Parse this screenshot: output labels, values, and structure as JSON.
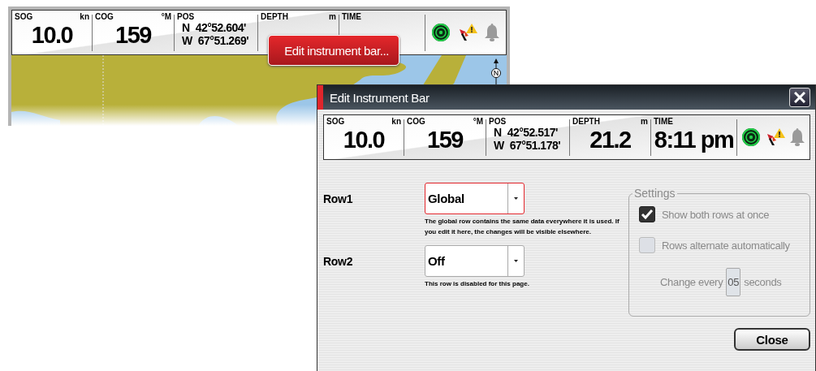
{
  "background_screen": {
    "instrument_bar": {
      "cells": [
        {
          "kind": "value",
          "label": "SOG",
          "unit": "kn",
          "value": "10.0"
        },
        {
          "kind": "value",
          "label": "COG",
          "unit": "°M",
          "value": "159"
        },
        {
          "kind": "position",
          "label": "POS",
          "lines": [
            {
              "prefix": "N",
              "value": "42°52.604'"
            },
            {
              "prefix": "W",
              "value": "67°51.269'"
            }
          ]
        },
        {
          "kind": "value",
          "label": "DEPTH",
          "unit": "m"
        },
        {
          "kind": "value",
          "label": "TIME"
        }
      ]
    },
    "context_menu": {
      "item": "Edit instrument bar..."
    }
  },
  "dialog": {
    "title": "Edit Instrument Bar",
    "instrument_bar": {
      "cells": [
        {
          "kind": "value",
          "label": "SOG",
          "unit": "kn",
          "value": "10.0"
        },
        {
          "kind": "value",
          "label": "COG",
          "unit": "°M",
          "value": "159"
        },
        {
          "kind": "position",
          "label": "POS",
          "lines": [
            {
              "prefix": "N",
              "value": "42°52.517'"
            },
            {
              "prefix": "W",
              "value": "67°51.178'"
            }
          ]
        },
        {
          "kind": "value",
          "label": "DEPTH",
          "unit": "m",
          "value": "21.2"
        },
        {
          "kind": "value",
          "label": "TIME",
          "value": "8:11 pm"
        }
      ]
    },
    "rows": [
      {
        "label": "Row1",
        "value": "Global",
        "focused": true,
        "hint": "The global row contains the same data everywhere it is used. If you edit it here, the changes will be visible elsewhere."
      },
      {
        "label": "Row2",
        "value": "Off",
        "focused": false,
        "hint": "This row is disabled for this page."
      }
    ],
    "settings": {
      "title": "Settings",
      "options": [
        {
          "label": "Show both rows at once",
          "checked": true
        },
        {
          "label": "Rows alternate automatically",
          "checked": false
        }
      ],
      "interval": {
        "prefix": "Change every",
        "value": "05",
        "suffix": "seconds"
      }
    },
    "buttons": [
      "Close"
    ]
  }
}
